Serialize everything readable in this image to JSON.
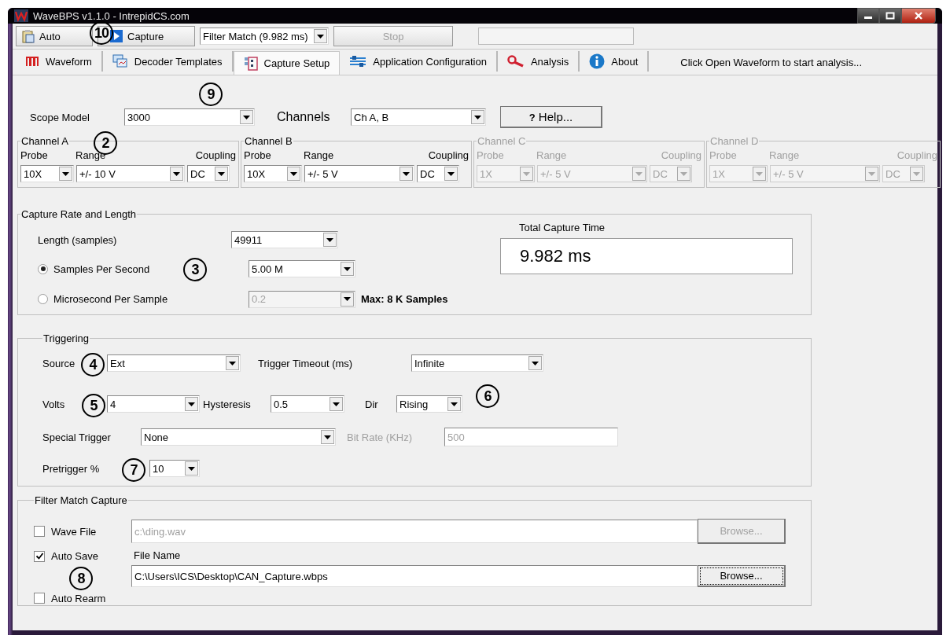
{
  "window": {
    "title": "WaveBPS v1.1.0 - IntrepidCS.com"
  },
  "toolbar": {
    "auto_button": "Auto",
    "capture_button": "Capture",
    "mode_combo": "Filter Match (9.982 ms)",
    "stop_button": {
      "label": "Stop",
      "disabled": true
    },
    "progress": {
      "level": 0
    }
  },
  "tabs": [
    {
      "label": "Waveform",
      "selected": false
    },
    {
      "label": "Decoder Templates",
      "selected": false
    },
    {
      "label": "Capture Setup",
      "selected": true
    },
    {
      "label": "Application Configuration",
      "selected": false
    },
    {
      "label": "Analysis",
      "selected": false
    },
    {
      "label": "About",
      "selected": false
    }
  ],
  "status_text": "Click Open Waveform to start analysis...",
  "scope": {
    "model_label": "Scope Model",
    "model": "3000",
    "channels_label": "Channels",
    "channels": "Ch A, B",
    "help_mark": "?",
    "help_button": "Help..."
  },
  "channel_groups": [
    {
      "title": "Channel A",
      "disabled": false,
      "probe_label": "Probe",
      "range_label": "Range",
      "coupling_label": "Coupling",
      "probe": "10X",
      "range": "+/- 10 V",
      "coupling": "DC"
    },
    {
      "title": "Channel B",
      "disabled": false,
      "probe_label": "Probe",
      "range_label": "Range",
      "coupling_label": "Coupling",
      "probe": "10X",
      "range": "+/- 5 V",
      "coupling": "DC"
    },
    {
      "title": "Channel C",
      "disabled": true,
      "probe_label": "Probe",
      "range_label": "Range",
      "coupling_label": "Coupling",
      "probe": "1X",
      "range": "+/- 5 V",
      "coupling": "DC"
    },
    {
      "title": "Channel D",
      "disabled": true,
      "probe_label": "Probe",
      "range_label": "Range",
      "coupling_label": "Coupling",
      "probe": "1X",
      "range": "+/- 5 V",
      "coupling": "DC"
    }
  ],
  "capture_rate": {
    "title": "Capture Rate and Length",
    "length_label": "Length (samples)",
    "length": "49911",
    "modes": [
      {
        "label": "Samples Per Second",
        "selected": true,
        "value": "5.00 M",
        "disabled": false
      },
      {
        "label": "Microsecond Per Sample",
        "selected": false,
        "value": "0.2",
        "disabled": true
      }
    ],
    "max_note": "Max: 8 K Samples",
    "total_label": "Total Capture Time",
    "total_value": "9.982 ms"
  },
  "triggering": {
    "title": "Triggering",
    "source_label": "Source",
    "source": "Ext",
    "timeout_label": "Trigger Timeout (ms)",
    "timeout": "Infinite",
    "volts_label": "Volts",
    "volts": "4",
    "hysteresis_label": "Hysteresis",
    "hysteresis": "0.5",
    "dir_label": "Dir",
    "dir": "Rising",
    "special_label": "Special Trigger",
    "special": "None",
    "bit_rate_label": "Bit Rate (KHz)",
    "bit_rate": {
      "value": "500",
      "disabled": true
    },
    "pretrigger_label": "Pretrigger %",
    "pretrigger": "10"
  },
  "filter_match": {
    "title": "Filter Match Capture",
    "options": [
      {
        "label": "Wave File",
        "checked": false
      },
      {
        "label": "Auto Save",
        "checked": true
      },
      {
        "label": "Auto Rearm",
        "checked": false
      }
    ],
    "wave_file": {
      "value": "c:\\ding.wav",
      "disabled": true
    },
    "wave_browse": {
      "label": "Browse...",
      "disabled": true
    },
    "file_name_label": "File Name",
    "file_name": "C:\\Users\\ICS\\Desktop\\CAN_Capture.wbps",
    "file_browse": {
      "label": "Browse...",
      "disabled": false
    }
  },
  "callouts": [
    "10",
    "9",
    "2",
    "3",
    "4",
    "5",
    "6",
    "7",
    "8"
  ]
}
